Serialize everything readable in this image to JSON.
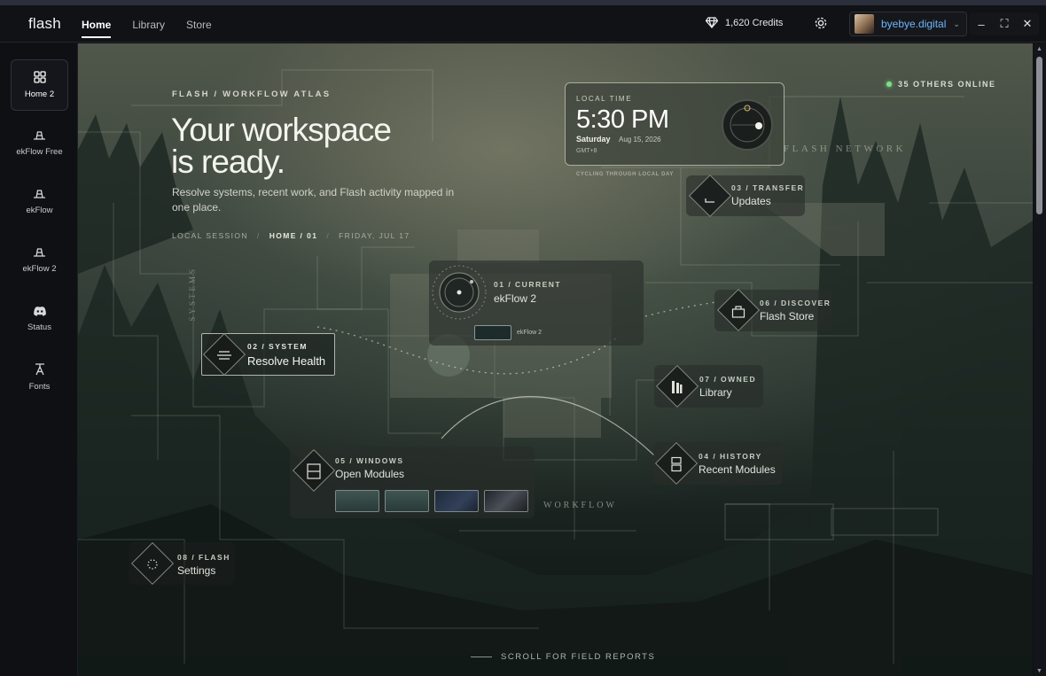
{
  "app": {
    "name": "flash"
  },
  "nav": {
    "tabs": [
      {
        "label": "Home",
        "active": true
      },
      {
        "label": "Library"
      },
      {
        "label": "Store"
      }
    ]
  },
  "header": {
    "credits": "1,620 Credits",
    "username": "byebye.digital",
    "accent": "#6cb6ff"
  },
  "window_controls": {
    "minimize": "–",
    "maximize": "⛶",
    "close": "✕"
  },
  "sidebar": {
    "items": [
      {
        "label": "Home 2",
        "icon": "grid-icon",
        "active": true
      },
      {
        "label": "ekFlow Free",
        "icon": "hat-icon"
      },
      {
        "label": "ekFlow",
        "icon": "hat-icon"
      },
      {
        "label": "ekFlow 2",
        "icon": "hat-icon"
      },
      {
        "label": "Status",
        "icon": "discord-icon"
      },
      {
        "label": "Fonts",
        "icon": "font-icon"
      }
    ]
  },
  "hero": {
    "eyebrow": "FLASH / WORKFLOW ATLAS",
    "title_line1": "Your workspace",
    "title_line2": "is ready.",
    "subtitle": "Resolve systems, recent work, and Flash activity mapped in one place.",
    "crumb_session": "LOCAL SESSION",
    "crumb_home": "HOME / 01",
    "crumb_date": "FRIDAY, JUL 17"
  },
  "online": {
    "text": "35 OTHERS ONLINE",
    "color": "#7fe089"
  },
  "local_time": {
    "label": "LOCAL TIME",
    "time": "5:30 PM",
    "day": "Saturday",
    "date": "Aug 15, 2026",
    "tz": "GMT+8",
    "caption": "CYCLING THROUGH LOCAL DAY"
  },
  "labels": {
    "flash_network": "FLASH NETWORK",
    "workflow": "WORKFLOW",
    "systems": "SYSTEMS"
  },
  "modules": {
    "current": {
      "kicker": "01 / CURRENT",
      "title": "ekFlow 2",
      "thumb_label": "ekFlow 2"
    },
    "system": {
      "kicker": "02 / SYSTEM",
      "title": "Resolve Health"
    },
    "transfer": {
      "kicker": "03 / TRANSFER",
      "title": "Updates"
    },
    "history": {
      "kicker": "04 / HISTORY",
      "title": "Recent Modules"
    },
    "windows": {
      "kicker": "05 / WINDOWS",
      "title": "Open Modules"
    },
    "discover": {
      "kicker": "06 / DISCOVER",
      "title": "Flash Store"
    },
    "owned": {
      "kicker": "07 / OWNED",
      "title": "Library"
    },
    "settings": {
      "kicker": "08 / FLASH",
      "title": "Settings"
    }
  },
  "scroll_hint": "SCROLL FOR FIELD REPORTS"
}
